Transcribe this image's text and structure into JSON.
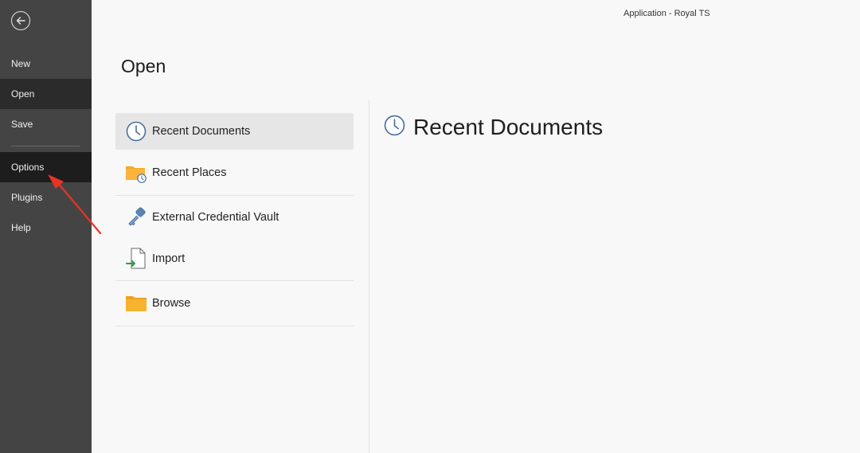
{
  "window": {
    "title": "Application - Royal TS"
  },
  "sidebar": {
    "back_icon": "back-arrow-circle-icon",
    "items": [
      {
        "label": "New"
      },
      {
        "label": "Open"
      },
      {
        "label": "Save"
      },
      {
        "label": "Options"
      },
      {
        "label": "Plugins"
      },
      {
        "label": "Help"
      }
    ],
    "active_item": "Open",
    "highlighted_item": "Options"
  },
  "main": {
    "title": "Open",
    "menu": [
      {
        "label": "Recent Documents",
        "icon": "clock-icon",
        "active": true
      },
      {
        "label": "Recent Places",
        "icon": "folder-clock-icon"
      },
      {
        "label": "External Credential Vault",
        "icon": "key-icon"
      },
      {
        "label": "Import",
        "icon": "import-file-icon"
      },
      {
        "label": "Browse",
        "icon": "folder-icon"
      }
    ],
    "pane": {
      "title": "Recent Documents",
      "icon": "clock-icon"
    }
  },
  "colors": {
    "sidebar_bg": "#444444",
    "sidebar_active": "#2b2b2b",
    "sidebar_selected": "#1d1d1d",
    "main_bg": "#f8f8f8",
    "menu_active_bg": "#e6e6e6",
    "accent_blue": "#3f6ea8",
    "folder_orange": "#f7a823",
    "annotation_red": "#ea3323"
  }
}
